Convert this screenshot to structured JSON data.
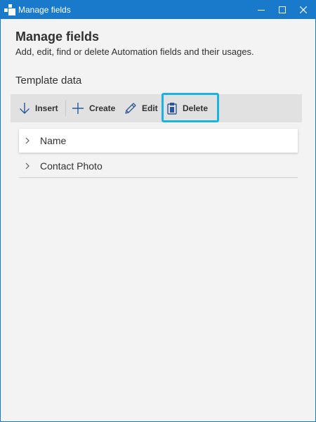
{
  "window": {
    "title": "Manage fields",
    "title_bar_color": "#1979ca"
  },
  "page": {
    "heading": "Manage fields",
    "subtitle": "Add, edit, find or delete Automation fields and their usages.",
    "section_title": "Template data"
  },
  "toolbar": {
    "insert_label": "Insert",
    "create_label": "Create",
    "edit_label": "Edit",
    "delete_label": "Delete",
    "highlight_color": "#19b3dd"
  },
  "fields": [
    {
      "label": "Name",
      "expanded": false
    },
    {
      "label": "Contact Photo",
      "expanded": false
    }
  ],
  "icons": [
    "app-icon",
    "minimize-icon",
    "maximize-icon",
    "close-icon",
    "arrow-down-icon",
    "plus-icon",
    "pencil-icon",
    "clipboard-delete-icon",
    "chevron-right-icon"
  ]
}
